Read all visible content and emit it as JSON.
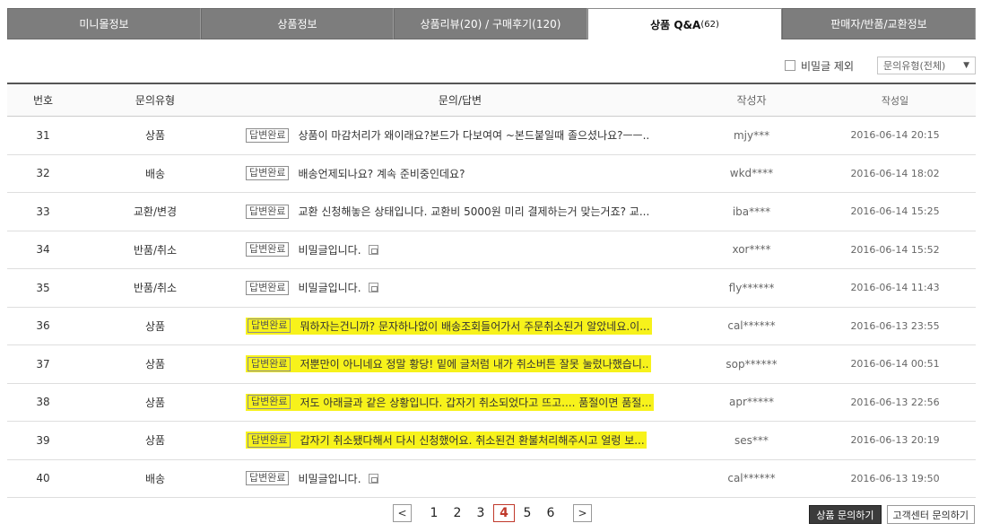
{
  "tabs": [
    {
      "label": "미니몰정보",
      "count": ""
    },
    {
      "label": "상품정보",
      "count": ""
    },
    {
      "label": "상품리뷰(20) / 구매후기(120)",
      "count": ""
    },
    {
      "label": "상품 Q&A",
      "count": "(62)"
    },
    {
      "label": "판매자/반품/교환정보",
      "count": ""
    }
  ],
  "filter": {
    "secret_exclude_label": "비밀글 제외",
    "type_select_value": "문의유형(전체)"
  },
  "table": {
    "headers": [
      "번호",
      "문의유형",
      "문의/답변",
      "작성자",
      "작성일"
    ],
    "rows": [
      {
        "num": "31",
        "type": "상품",
        "badge": "답변완료",
        "text": "상품이 마감처리가 왜이래요?본드가 다보여여 ~본드붙일때 졸으셨나요?ㅡㅡ..",
        "writer": "mjy***",
        "date": "2016-06-14 20:15"
      },
      {
        "num": "32",
        "type": "배송",
        "badge": "답변완료",
        "text": "배송언제되나요? 계속 준비중인데요?",
        "writer": "wkd****",
        "date": "2016-06-14 18:02"
      },
      {
        "num": "33",
        "type": "교환/변경",
        "badge": "답변완료",
        "text": "교환 신청해놓은 상태입니다. 교환비 5000원 미리 결제하는거 맞는거죠? 교...",
        "writer": "iba****",
        "date": "2016-06-14 15:25"
      },
      {
        "num": "34",
        "type": "반품/취소",
        "badge": "답변완료",
        "text": "비밀글입니다.",
        "writer": "xor****",
        "date": "2016-06-14 15:52"
      },
      {
        "num": "35",
        "type": "반품/취소",
        "badge": "답변완료",
        "text": "비밀글입니다.",
        "writer": "fly******",
        "date": "2016-06-14 11:43"
      },
      {
        "num": "36",
        "type": "상품",
        "badge": "답변완료",
        "text": "뭐하자는건니까? 문자하나없이 배송조회들어가서 주문취소된거 알았네요.이...",
        "writer": "cal******",
        "date": "2016-06-13 23:55"
      },
      {
        "num": "37",
        "type": "상품",
        "badge": "답변완료",
        "text": "저뿐만이 아니네요 정말 황당! 밑에 글처럼 내가 취소버튼 잘못 눌렀나했습니..",
        "writer": "sop******",
        "date": "2016-06-14 00:51"
      },
      {
        "num": "38",
        "type": "상품",
        "badge": "답변완료",
        "text": "저도 아래글과 같은 상황입니다. 갑자기 취소되었다고 뜨고.... 품절이면 품절...",
        "writer": "apr*****",
        "date": "2016-06-13 22:56"
      },
      {
        "num": "39",
        "type": "상품",
        "badge": "답변완료",
        "text": "갑자기 취소됐다해서 다시 신청했어요. 취소된건 환불처리해주시고 얼렁 보...",
        "writer": "ses***",
        "date": "2016-06-13 20:19"
      },
      {
        "num": "40",
        "type": "배송",
        "badge": "답변완료",
        "text": "비밀글입니다.",
        "writer": "cal******",
        "date": "2016-06-13 19:50"
      }
    ]
  },
  "pager": {
    "prev": "<",
    "next": ">",
    "pages": [
      "1",
      "2",
      "3",
      "4",
      "5",
      "6"
    ],
    "current": "4"
  },
  "buttons": {
    "product_inquiry": "상품 문의하기",
    "cs_inquiry": "고객센터 문의하기"
  }
}
